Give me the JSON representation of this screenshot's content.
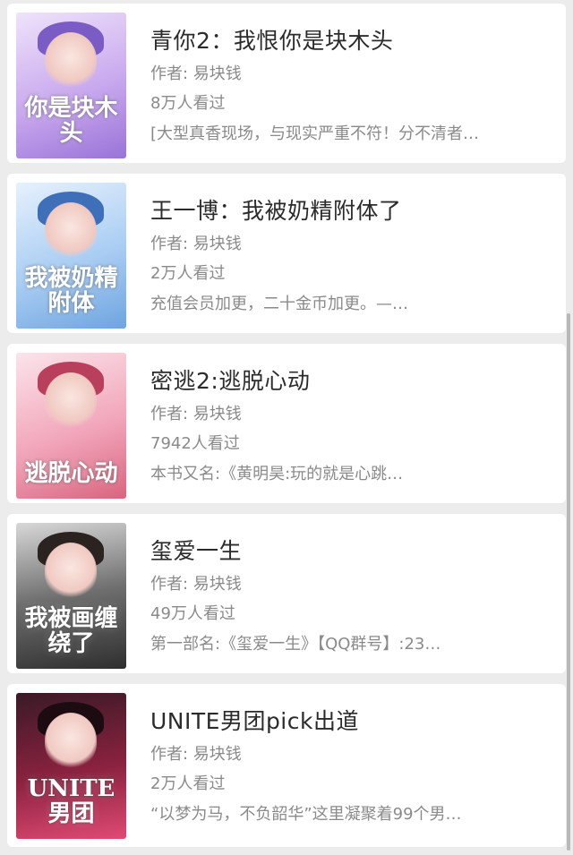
{
  "books": [
    {
      "title": "青你2：我恨你是块木头",
      "author": "作者: 易块钱",
      "views": "8万人看过",
      "description": "[大型真香现场，与现实严重不符！分不清者…",
      "cover_text": "你是块木头",
      "cover_colors": [
        "#efe3fb",
        "#c9a9ee",
        "#9a73d8"
      ]
    },
    {
      "title": "王一博：我被奶精附体了",
      "author": "作者: 易块钱",
      "views": "2万人看过",
      "description": "充值会员加更，二十金币加更。—…",
      "cover_text": "我被奶精附体",
      "cover_colors": [
        "#e6f1fd",
        "#a9cdf3",
        "#6ea4e0"
      ]
    },
    {
      "title": "密逃2:逃脱心动",
      "author": "作者: 易块钱",
      "views": "7942人看过",
      "description": "本书又名:《黄明昊:玩的就是心跳…",
      "cover_text": "逃脱心动",
      "cover_colors": [
        "#fbe4ea",
        "#f2a6bb",
        "#d9647f"
      ]
    },
    {
      "title": "玺爱一生",
      "author": "作者: 易块钱",
      "views": "49万人看过",
      "description": "第一部名:《玺爱一生》【QQ群号】:23…",
      "cover_text": "我被画缠绕了",
      "cover_colors": [
        "#d8d8d8",
        "#6e6e6e",
        "#2f2f2f"
      ]
    },
    {
      "title": "UNITE男团pick出道",
      "author": "作者: 易块钱",
      "views": "2万人看过",
      "description": "“以梦为马，不负韶华”这里凝聚着99个男…",
      "cover_text": "UNITE男团",
      "cover_colors": [
        "#3a1a26",
        "#8c2240",
        "#e04a74"
      ]
    }
  ]
}
